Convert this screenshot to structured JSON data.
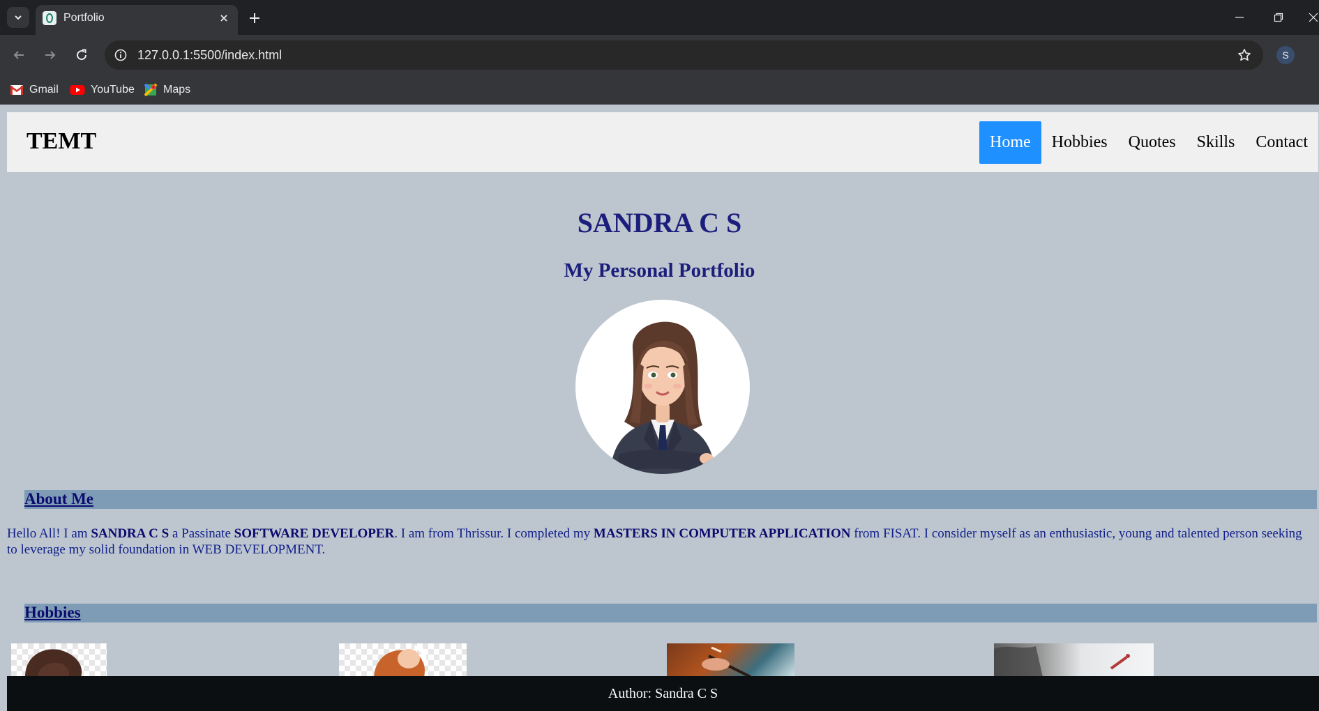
{
  "browser": {
    "tab_title": "Portfolio",
    "url": "127.0.0.1:5500/index.html",
    "profile_initial": "S",
    "bookmarks": [
      {
        "label": "Gmail",
        "icon": "gmail-icon"
      },
      {
        "label": "YouTube",
        "icon": "youtube-icon"
      },
      {
        "label": "Maps",
        "icon": "maps-icon"
      }
    ]
  },
  "page": {
    "brand": "TEMT",
    "nav": [
      "Home",
      "Hobbies",
      "Quotes",
      "Skills",
      "Contact"
    ],
    "active_nav": "Home",
    "name": "SANDRA C S",
    "subtitle": "My Personal Portfolio",
    "avatar": "avatar-illustration",
    "about": {
      "heading": "About Me",
      "text_segments": [
        {
          "text": "Hello All! I am ",
          "bold": false
        },
        {
          "text": "SANDRA C S",
          "bold": true
        },
        {
          "text": " a Passinate ",
          "bold": false
        },
        {
          "text": "SOFTWARE DEVELOPER",
          "bold": true
        },
        {
          "text": ". I am from Thrissur. I completed my ",
          "bold": false
        },
        {
          "text": "MASTERS IN COMPUTER APPLICATION",
          "bold": true
        },
        {
          "text": " from FISAT. I consider myself as an enthusiastic, young and talented person seeking to leverage my solid foundation in WEB DEVELOPMENT.",
          "bold": false
        }
      ]
    },
    "hobbies": {
      "heading": "Hobbies",
      "images": [
        "hobby-image-1",
        "hobby-image-2",
        "hobby-image-3",
        "hobby-image-4"
      ]
    },
    "footer": "Author: Sandra C S"
  },
  "colors": {
    "page_bg": "#bdc6cf",
    "heading": "#1b1e7b",
    "active_nav": "#1e90ff",
    "section_bar": "#7f9cb7",
    "footer_bg": "#0b0f12"
  }
}
